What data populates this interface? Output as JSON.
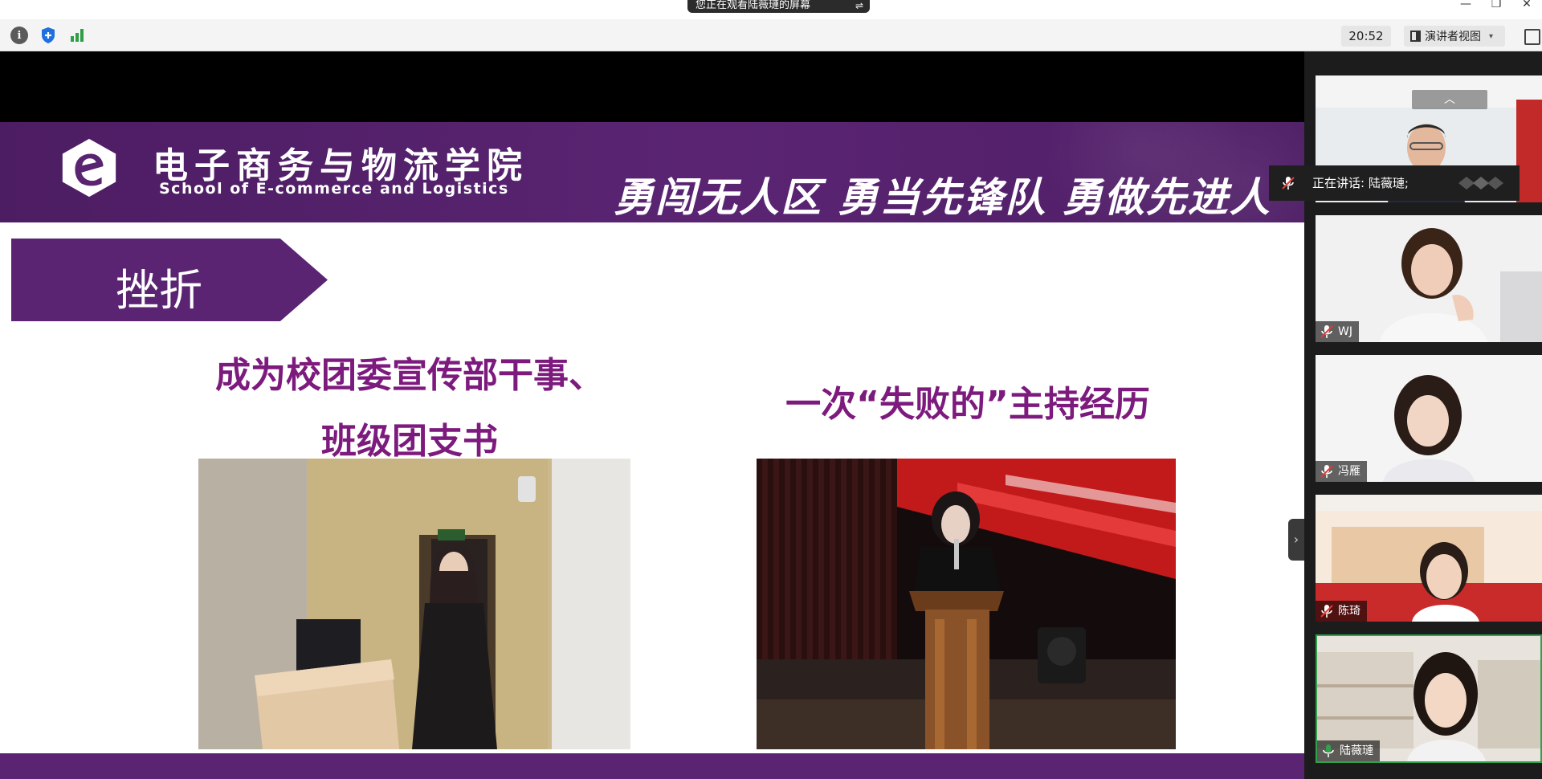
{
  "window": {
    "share_banner": "您正在观看陆薇璉的屏幕",
    "banner_menu_icon": "menu-lines-icon",
    "controls": [
      "—",
      "❐",
      "✕"
    ]
  },
  "toolbar": {
    "info_icon": "i",
    "time": "20:52",
    "view_mode": "演讲者视图",
    "view_chevron": "▾"
  },
  "slide": {
    "school_name_cn": "电子商务与物流学院",
    "school_name_en": "School of E-commerce and Logistics",
    "slogan": "勇闯无人区  勇当先锋队  勇做先进人",
    "section_title": "挫折",
    "heading_left_line1": "成为校团委宣传部干事、",
    "heading_left_line2": "班级团支书",
    "heading_right": "一次“失败的”主持经历",
    "colors": {
      "purple": "#5a2472",
      "heading": "#7d1a7d"
    }
  },
  "panel": {
    "toggle_icon": "›",
    "scroll_up_icon": "︿",
    "speaking_label": "正在讲话: 陆薇璉;",
    "participants": [
      {
        "name": "WJ"
      },
      {
        "name": "冯雁"
      },
      {
        "name": "陈琦"
      },
      {
        "name": "陆薇璉"
      }
    ],
    "active_color": "#2fa24b"
  }
}
